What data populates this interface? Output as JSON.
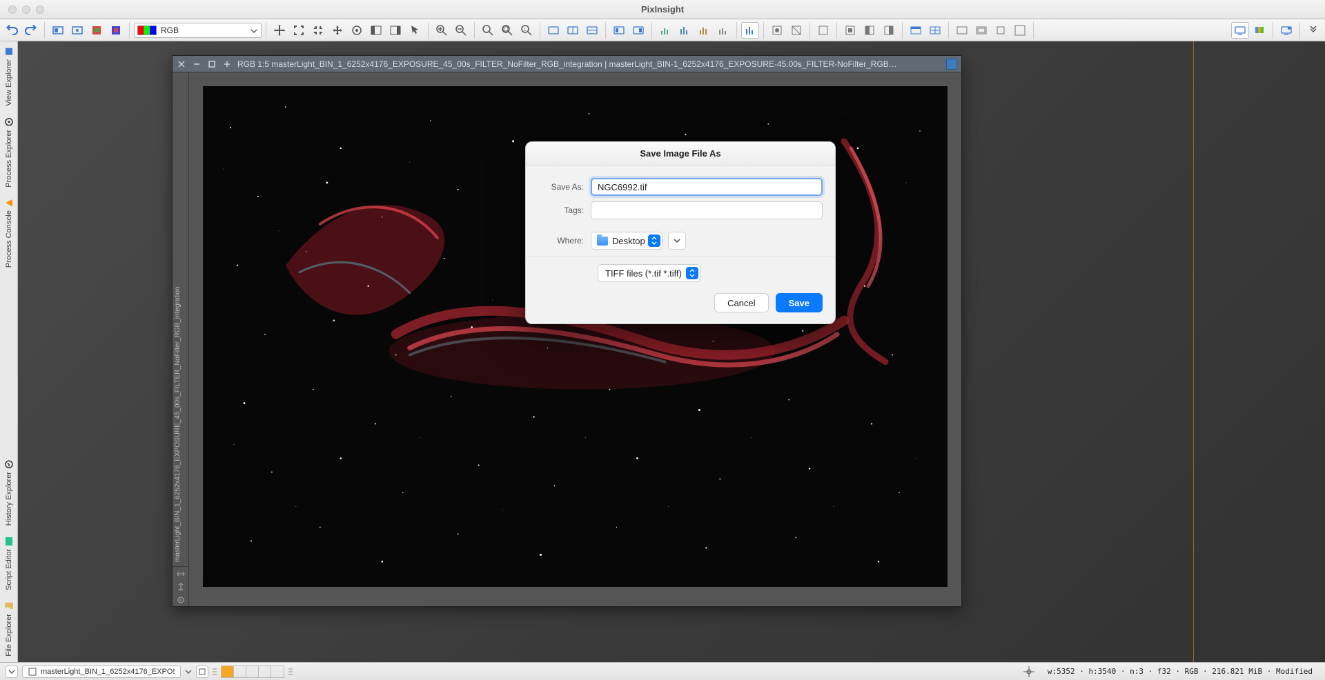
{
  "app": {
    "title": "PixInsight"
  },
  "toolbar": {
    "channel_label": "RGB"
  },
  "left_rail": {
    "top": [
      {
        "label": "Process Console"
      },
      {
        "label": "Process Explorer"
      },
      {
        "label": "View Explorer"
      }
    ],
    "bottom": [
      {
        "label": "File Explorer"
      },
      {
        "label": "Script Editor"
      },
      {
        "label": "History Explorer"
      }
    ]
  },
  "image_window": {
    "title": "RGB 1:5 masterLight_BIN_1_6252x4176_EXPOSURE_45_00s_FILTER_NoFilter_RGB_integration | masterLight_BIN-1_6252x4176_EXPOSURE-45.00s_FILTER-NoFilter_RGB…",
    "side_label": "masterLight_BIN_1_6252x4176_EXPOSURE_45_00s_FILTER_NoFilter_RGB_integration"
  },
  "save_dialog": {
    "title": "Save Image File As",
    "save_as_label": "Save As:",
    "filename": "NGC6992.tif",
    "tags_label": "Tags:",
    "tags_value": "",
    "where_label": "Where:",
    "where_value": "Desktop",
    "filetype": "TIFF files (*.tif *.tiff)",
    "cancel": "Cancel",
    "save": "Save"
  },
  "statusbar": {
    "tab": "masterLight_BIN_1_6252x4176_EXPO!",
    "info": "w:5352 · h:3540 · n:3 · f32 · RGB · 216.821 MiB · Modified"
  }
}
